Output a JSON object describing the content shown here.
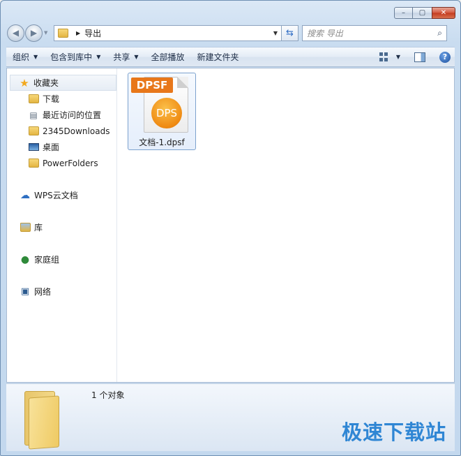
{
  "window": {
    "caption": {
      "minimize": "–",
      "maximize": "▢",
      "close": "✕"
    }
  },
  "nav": {
    "back": "◀",
    "forward": "▶",
    "address_path": "导出",
    "search_placeholder": "搜索 导出"
  },
  "toolbar": {
    "organize": "组织",
    "include_in_library": "包含到库中",
    "share": "共享",
    "play_all": "全部播放",
    "new_folder": "新建文件夹",
    "help": "?"
  },
  "sidebar": {
    "favorites": "收藏夹",
    "favorites_items": [
      "下载",
      "最近访问的位置",
      "2345Downloads",
      "桌面",
      "PowerFolders"
    ],
    "wps_cloud": "WPS云文档",
    "libraries": "库",
    "homegroup": "家庭组",
    "network": "网络"
  },
  "files": [
    {
      "badge": "DPSF",
      "logo": "DPS",
      "name": "文档-1.dpsf"
    }
  ],
  "details": {
    "count": "1 个对象"
  },
  "watermark": "极速下载站",
  "colors": {
    "accent": "#2f86d4",
    "dpsf_orange": "#e8771a"
  }
}
